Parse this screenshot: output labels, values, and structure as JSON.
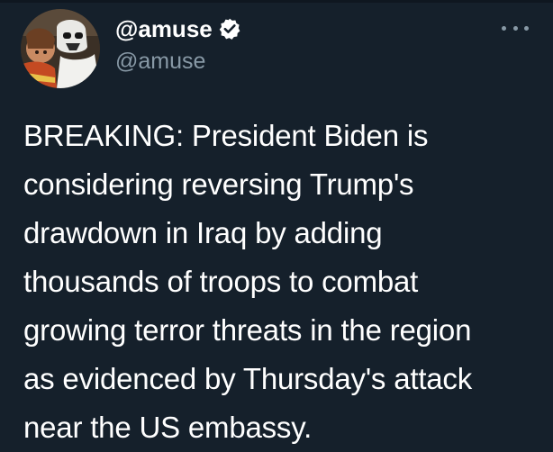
{
  "author": {
    "display_name": "@amuse",
    "handle": "@amuse",
    "verified": true
  },
  "icons": {
    "verified": "verified-badge-icon",
    "more": "more-options-icon"
  },
  "tweet": {
    "text": "BREAKING: President Biden is\nconsidering reversing Trump's\ndrawdown in Iraq by adding\nthousands of troops to combat\ngrowing terror threats in the region\nas evidenced by Thursday's attack\nnear the US embassy."
  },
  "colors": {
    "background": "#15202b",
    "text": "#ffffff",
    "secondary_text": "#8899a6"
  }
}
